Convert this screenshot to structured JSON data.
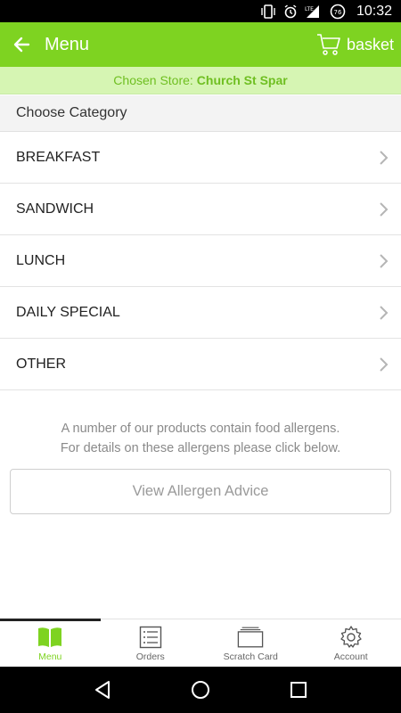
{
  "status_bar": {
    "time": "10:32",
    "network": "LTE",
    "battery_level": "76"
  },
  "app_bar": {
    "title": "Menu",
    "basket_label": "basket"
  },
  "store_banner": {
    "prefix": "Chosen Store:",
    "store_name": "Church St Spar"
  },
  "category_header": "Choose Category",
  "categories": [
    {
      "label": "BREAKFAST"
    },
    {
      "label": "SANDWICH"
    },
    {
      "label": "LUNCH"
    },
    {
      "label": "DAILY SPECIAL"
    },
    {
      "label": "OTHER"
    }
  ],
  "allergen": {
    "line1": "A number of our products contain food allergens.",
    "line2": "For details on these allergens please click below.",
    "button_label": "View Allergen Advice"
  },
  "bottom_nav": {
    "items": [
      {
        "label": "Menu",
        "icon": "book-icon",
        "active": true
      },
      {
        "label": "Orders",
        "icon": "list-icon",
        "active": false
      },
      {
        "label": "Scratch Card",
        "icon": "card-stack-icon",
        "active": false
      },
      {
        "label": "Account",
        "icon": "gear-icon",
        "active": false
      }
    ]
  },
  "colors": {
    "accent": "#7ed321",
    "banner_bg": "#d6f5b3",
    "banner_text": "#6fbf21"
  }
}
